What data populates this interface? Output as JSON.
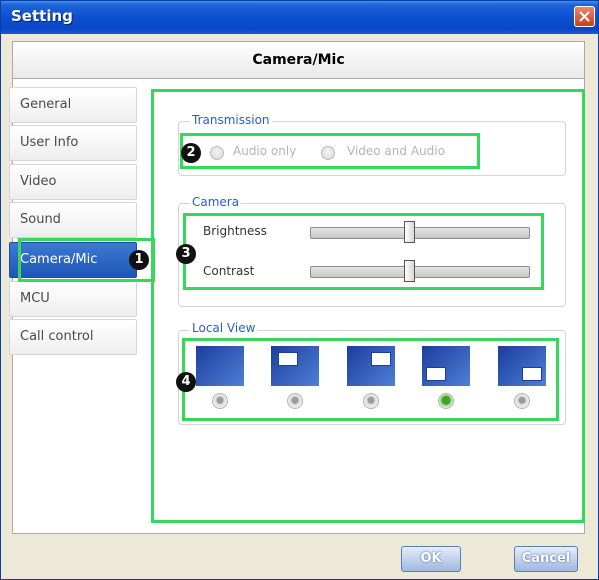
{
  "window": {
    "title": "Setting"
  },
  "header": {
    "title": "Camera/Mic"
  },
  "sidebar": {
    "items": [
      {
        "label": "General"
      },
      {
        "label": "User Info"
      },
      {
        "label": "Video"
      },
      {
        "label": "Sound"
      },
      {
        "label": "Camera/Mic",
        "selected": true
      },
      {
        "label": "MCU"
      },
      {
        "label": "Call control"
      }
    ]
  },
  "badges": {
    "one": "1",
    "two": "2",
    "three": "3",
    "four": "4"
  },
  "transmission": {
    "legend": "Transmission",
    "options": [
      {
        "label": "Audio only"
      },
      {
        "label": "Video and Audio"
      }
    ]
  },
  "camera": {
    "legend": "Camera",
    "brightness": {
      "label": "Brightness",
      "level": 0.45
    },
    "contrast": {
      "label": "Contrast",
      "level": 0.45
    }
  },
  "local_view": {
    "legend": "Local View",
    "options": [
      "none",
      "top-left",
      "top-right",
      "bottom-left",
      "bottom-right"
    ],
    "selected_index": 3
  },
  "footer": {
    "ok_label": "OK",
    "cancel_label": "Cancel"
  },
  "colors": {
    "highlight": "#34d95c",
    "selected_tab": "#2b63c3",
    "title_bar": "#0b4fd0"
  }
}
